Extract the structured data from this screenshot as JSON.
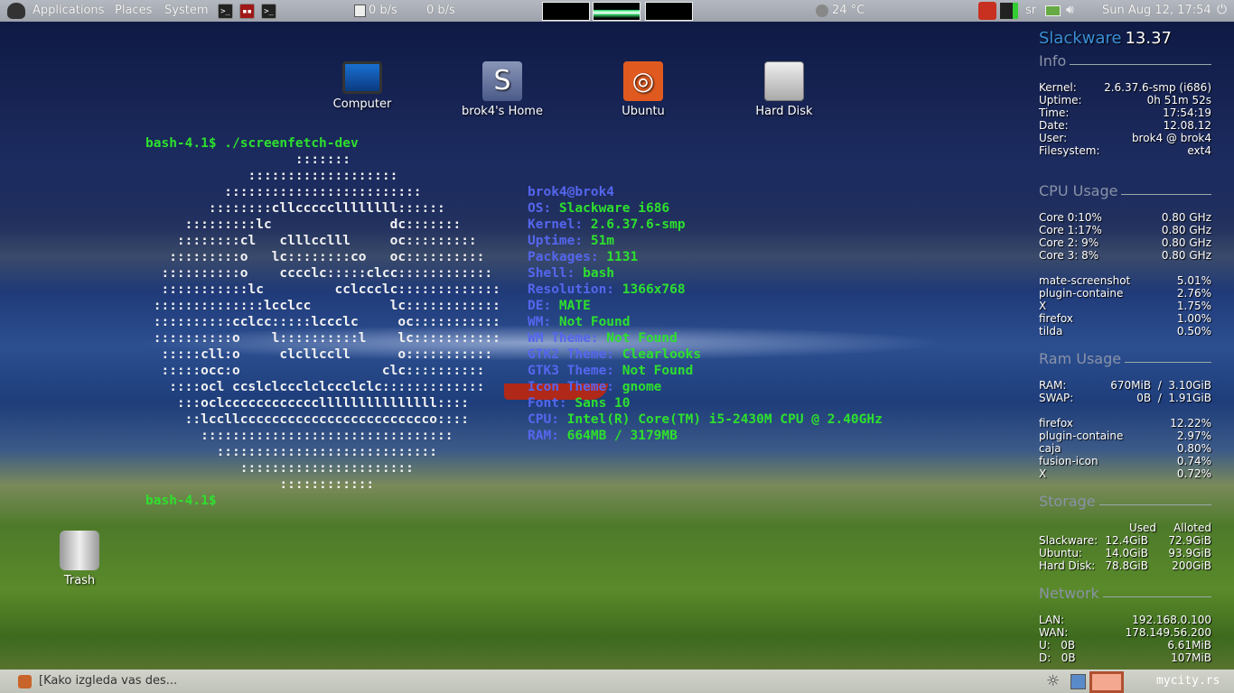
{
  "topbar": {
    "menus": [
      "Applications",
      "Places",
      "System"
    ],
    "net_down": "0 b/s",
    "net_up": "0 b/s",
    "weather": "24 °C",
    "keyboard": "sr",
    "clock": "Sun Aug 12, 17:54"
  },
  "desktop": {
    "icons": [
      "Computer",
      "brok4's Home",
      "Ubuntu",
      "Hard Disk",
      "Trash"
    ]
  },
  "terminal": {
    "prompt1": "bash-4.1$ ./screenfetch-dev",
    "prompt2": "bash-4.1$",
    "art": [
      "                   :::::::",
      "             :::::::::::::::::::",
      "          :::::::::::::::::::::::::",
      "        ::::::::cllcccccllllllll::::::",
      "     :::::::::lc               dc:::::::",
      "    ::::::::cl   clllcclll     oc:::::::::",
      "   :::::::::o   lc::::::::co   oc::::::::::",
      "  ::::::::::o    cccclc:::::clcc::::::::::::",
      "  :::::::::::lc         cclccclc:::::::::::::",
      " ::::::::::::::lcclcc          lc::::::::::::",
      " ::::::::::cclcc:::::lccclc     oc:::::::::::",
      " ::::::::::o    l::::::::::l    lc:::::::::::",
      "  :::::cll:o     clcllccll      o:::::::::::",
      "  :::::occ:o                  clc::::::::::",
      "   ::::ocl ccslclccclclccclclc:::::::::::::",
      "    :::oclcccccccccccclllllllllllllll::::",
      "     ::lccllcccccccccccccccccccccccco::::",
      "       ::::::::::::::::::::::::::::::::",
      "         ::::::::::::::::::::::::::::",
      "            ::::::::::::::::::::::",
      "                 ::::::::::::"
    ],
    "info": [
      {
        "label": "brok4@brok4",
        "value": ""
      },
      {
        "label": "OS:",
        "value": "Slackware i686"
      },
      {
        "label": "Kernel:",
        "value": "2.6.37.6-smp"
      },
      {
        "label": "Uptime:",
        "value": "51m"
      },
      {
        "label": "Packages:",
        "value": "1131"
      },
      {
        "label": "Shell:",
        "value": "bash"
      },
      {
        "label": "Resolution:",
        "value": "1366x768"
      },
      {
        "label": "DE:",
        "value": "MATE"
      },
      {
        "label": "WM:",
        "value": "Not Found"
      },
      {
        "label": "WM Theme:",
        "value": "Not Found"
      },
      {
        "label": "GTK2 Theme:",
        "value": "Clearlooks"
      },
      {
        "label": "GTK3 Theme:",
        "value": "Not Found"
      },
      {
        "label": "Icon Theme:",
        "value": "gnome"
      },
      {
        "label": "Font:",
        "value": "Sans 10"
      },
      {
        "label": "CPU:",
        "value": "Intel(R) Core(TM) i5-2430M CPU @ 2.40GHz"
      },
      {
        "label": "RAM:",
        "value": "664MB / 3179MB"
      }
    ]
  },
  "conky": {
    "distro": "Slackware",
    "version": "13.37",
    "info_title": "Info",
    "info": [
      [
        "Kernel:",
        "2.6.37.6-smp (i686)"
      ],
      [
        "Uptime:",
        "0h 51m 52s"
      ],
      [
        "Time:",
        "17:54:19"
      ],
      [
        "Date:",
        "12.08.12"
      ],
      [
        "User:",
        "brok4 @ brok4"
      ],
      [
        "Filesystem:",
        "ext4"
      ]
    ],
    "cpu_title": "CPU Usage",
    "cores": [
      [
        "Core 0:10%",
        "0.80 GHz"
      ],
      [
        "Core 1:17%",
        "0.80 GHz"
      ],
      [
        "Core 2: 9%",
        "0.80 GHz"
      ],
      [
        "Core 3: 8%",
        "0.80 GHz"
      ]
    ],
    "cpu_procs": [
      [
        "mate-screenshot",
        "5.01%"
      ],
      [
        "plugin-containe",
        "2.76%"
      ],
      [
        "X",
        "1.75%"
      ],
      [
        "firefox",
        "1.00%"
      ],
      [
        "tilda",
        "0.50%"
      ]
    ],
    "ram_title": "Ram Usage",
    "ram": [
      [
        "RAM:",
        "670MiB  /  3.10GiB"
      ],
      [
        "SWAP:",
        "0B  /  1.91GiB"
      ]
    ],
    "ram_procs": [
      [
        "firefox",
        "12.22%"
      ],
      [
        "plugin-containe",
        "2.97%"
      ],
      [
        "caja",
        "0.80%"
      ],
      [
        "fusion-icon",
        "0.74%"
      ],
      [
        "X",
        "0.72%"
      ]
    ],
    "storage_title": "Storage",
    "storage_cols": [
      "Used",
      "Alloted"
    ],
    "storage": [
      [
        "Slackware:",
        "12.4GiB",
        "72.9GiB"
      ],
      [
        "Ubuntu:",
        "14.0GiB",
        "93.9GiB"
      ],
      [
        "Hard Disk:",
        "78.8GiB",
        "200GiB"
      ]
    ],
    "network_title": "Network",
    "network": [
      [
        "LAN:",
        "192.168.0.100"
      ],
      [
        "WAN:",
        "178.149.56.200"
      ],
      [
        "U:   0B",
        "6.61MiB"
      ],
      [
        "D:   0B",
        "107MiB"
      ]
    ]
  },
  "bottombar": {
    "task": "[Kako izgleda vas des...",
    "brand": "mycity.rs"
  }
}
